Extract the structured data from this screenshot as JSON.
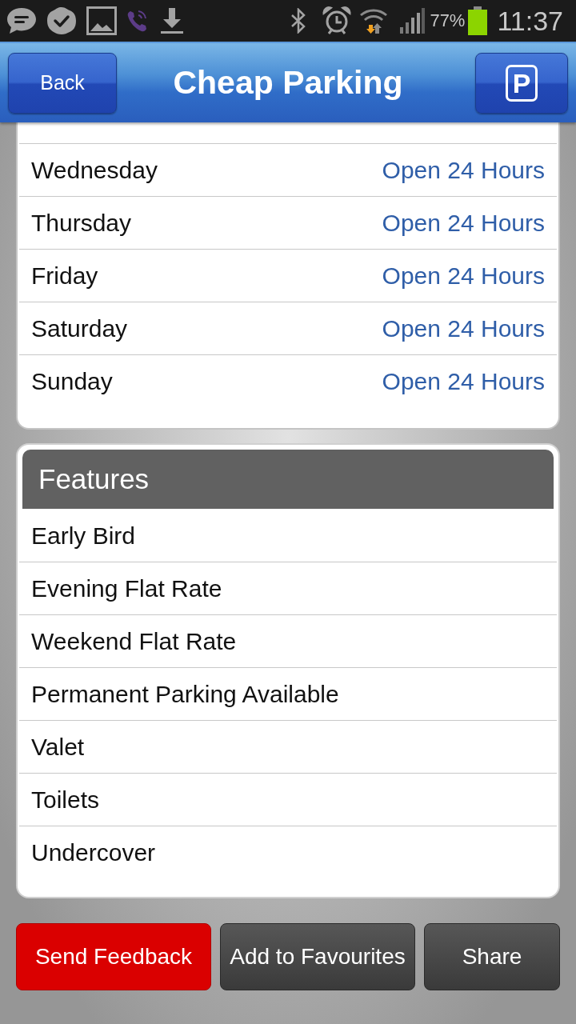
{
  "status_bar": {
    "battery": "77%",
    "time": "11:37"
  },
  "header": {
    "back_button": "Back",
    "title": "Cheap Parking",
    "parking_button": "P"
  },
  "opening_hours": [
    {
      "day": "Wednesday",
      "hours": "Open 24 Hours"
    },
    {
      "day": "Thursday",
      "hours": "Open 24 Hours"
    },
    {
      "day": "Friday",
      "hours": "Open 24 Hours"
    },
    {
      "day": "Saturday",
      "hours": "Open 24 Hours"
    },
    {
      "day": "Sunday",
      "hours": "Open 24 Hours"
    }
  ],
  "features": {
    "title": "Features",
    "items": [
      "Early Bird",
      "Evening Flat Rate",
      "Weekend Flat Rate",
      "Permanent Parking Available",
      "Valet",
      "Toilets",
      "Undercover"
    ]
  },
  "actions": [
    {
      "label": "Send Feedback",
      "kind": "alert"
    },
    {
      "label": "Add to Favourites",
      "kind": "normal"
    },
    {
      "label": "Share",
      "kind": "normal"
    }
  ]
}
